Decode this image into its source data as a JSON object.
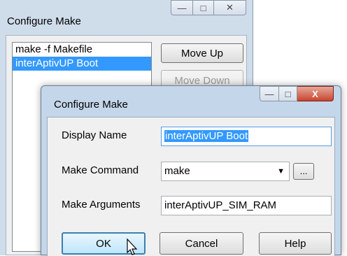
{
  "back_window": {
    "title": "Configure Make",
    "caption_buttons": {
      "minimize": "—",
      "maximize": "□",
      "close": "✕"
    },
    "list_items": [
      "make -f Makefile",
      "interAptivUP Boot"
    ],
    "selected_index": 1,
    "move_up_label": "Move Up",
    "move_down_label": "Move Down"
  },
  "dialog": {
    "title": "Configure Make",
    "caption_buttons": {
      "minimize": "—",
      "maximize": "□",
      "close": "X"
    },
    "display_name_label": "Display Name",
    "display_name_value": "interAptivUP Boot",
    "make_command_label": "Make Command",
    "make_command_value": "make",
    "browse_label": "...",
    "make_arguments_label": "Make Arguments",
    "make_arguments_value": "interAptivUP_SIM_RAM",
    "ok_label": "OK",
    "cancel_label": "Cancel",
    "help_label": "Help"
  }
}
